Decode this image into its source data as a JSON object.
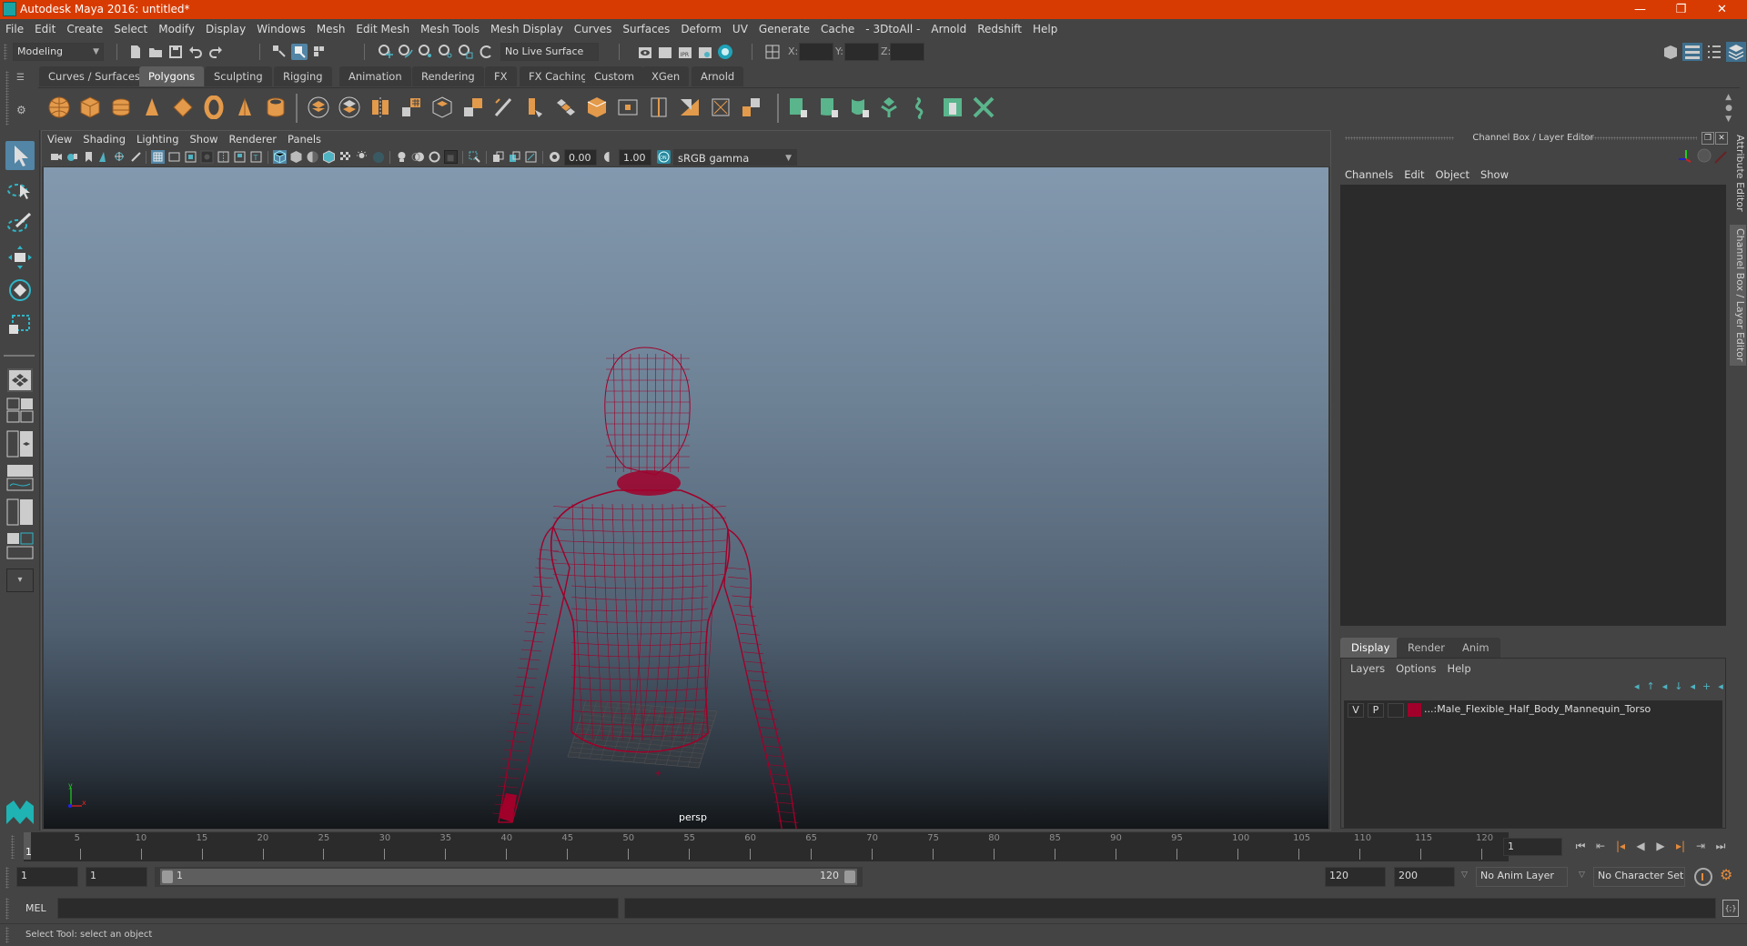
{
  "window": {
    "title": "Autodesk Maya 2016: untitled*",
    "minimize_icon": "minimize-icon",
    "restore_icon": "restore-icon",
    "close_icon": "close-icon"
  },
  "menubar": [
    "File",
    "Edit",
    "Create",
    "Select",
    "Modify",
    "Display",
    "Windows",
    "Mesh",
    "Edit Mesh",
    "Mesh Tools",
    "Mesh Display",
    "Curves",
    "Surfaces",
    "Deform",
    "UV",
    "Generate",
    "Cache",
    "- 3DtoAll -",
    "Arnold",
    "Redshift",
    "Help"
  ],
  "statusline": {
    "menuset": "Modeling",
    "live_surface": "No Live Surface",
    "x_label": "X:",
    "y_label": "Y:",
    "z_label": "Z:",
    "x_value": "",
    "y_value": "",
    "z_value": ""
  },
  "shelf": {
    "tabs": [
      "Curves / Surfaces",
      "Polygons",
      "Sculpting",
      "Rigging",
      "Animation",
      "Rendering",
      "FX",
      "FX Caching",
      "Custom",
      "XGen",
      "Arnold"
    ],
    "active_tab": "Polygons"
  },
  "viewport": {
    "menu": [
      "View",
      "Shading",
      "Lighting",
      "Show",
      "Renderer",
      "Panels"
    ],
    "exposure": "0.00",
    "gamma": "1.00",
    "color_space": "sRGB gamma",
    "camera_label": "persp",
    "axis_x": "x",
    "axis_y": "y",
    "wire_color": "#a0002a"
  },
  "channelbox": {
    "title": "Channel Box / Layer Editor",
    "menu": [
      "Channels",
      "Edit",
      "Object",
      "Show"
    ],
    "layer_tabs": [
      "Display",
      "Render",
      "Anim"
    ],
    "active_layer_tab": "Display",
    "layer_menu": [
      "Layers",
      "Options",
      "Help"
    ],
    "layers": [
      {
        "visible": "V",
        "playback": "P",
        "color": "#a0002a",
        "name": "...:Male_Flexible_Half_Body_Mannequin_Torso"
      }
    ]
  },
  "side_tabs": [
    "Attribute Editor",
    "Channel Box / Layer Editor"
  ],
  "timeline": {
    "ticks": [
      "5",
      "10",
      "15",
      "20",
      "25",
      "30",
      "35",
      "40",
      "45",
      "50",
      "55",
      "60",
      "65",
      "70",
      "75",
      "80",
      "85",
      "90",
      "95",
      "100",
      "105",
      "110",
      "115",
      "120"
    ],
    "current_frame_marker": "1",
    "current_frame": "1"
  },
  "range": {
    "start_time": "1",
    "playback_start": "1",
    "slider_start": "1",
    "slider_end": "120",
    "playback_end": "120",
    "end_time": "200",
    "anim_layer": "No Anim Layer",
    "character_set": "No Character Set"
  },
  "mel": {
    "label": "MEL",
    "input": "",
    "output": ""
  },
  "helpline": "Select Tool: select an object"
}
